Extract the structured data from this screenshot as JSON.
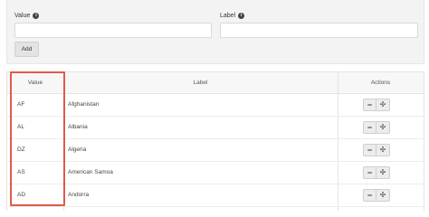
{
  "form": {
    "value_label": "Value",
    "label_label": "Label",
    "info_glyph": "i",
    "value_input": "",
    "label_input": "",
    "add_button": "Add"
  },
  "table": {
    "headers": {
      "value": "Value",
      "label": "Label",
      "actions": "Actions"
    },
    "rows": [
      {
        "value": "AF",
        "label": "Afghanistan"
      },
      {
        "value": "AL",
        "label": "Albania"
      },
      {
        "value": "DZ",
        "label": "Algeria"
      },
      {
        "value": "AS",
        "label": "American Samoa"
      },
      {
        "value": "AD",
        "label": "Andorra"
      }
    ],
    "action_icons": {
      "minus": "−",
      "plus": "✢"
    }
  },
  "colors": {
    "highlight": "#e05a4a",
    "panel_bg": "#f3f3f3"
  }
}
